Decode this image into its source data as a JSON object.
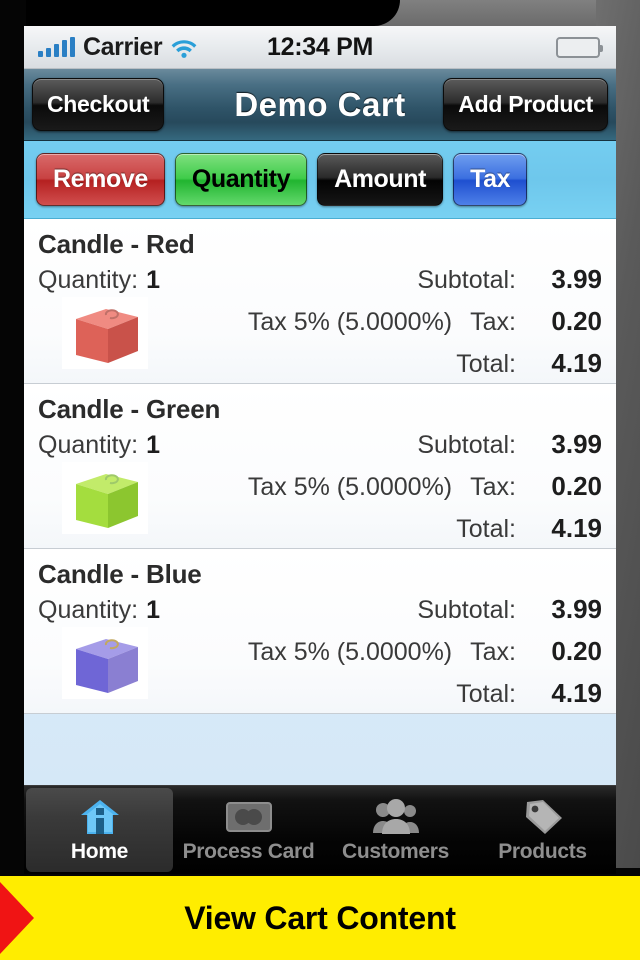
{
  "status_bar": {
    "carrier": "Carrier",
    "time": "12:34 PM",
    "signal_icon": "signal-bars-icon",
    "wifi_icon": "wifi-icon",
    "battery_icon": "battery-icon"
  },
  "nav_bar": {
    "left_button": "Checkout",
    "title": "Demo Cart",
    "right_button": "Add Product"
  },
  "action_bar": {
    "buttons": [
      {
        "label": "Remove",
        "color": "#c84242",
        "text_color": "#ffffff"
      },
      {
        "label": "Quantity",
        "color": "#3fcc4a",
        "text_color": "#000000"
      },
      {
        "label": "Amount",
        "color": "#0a0a0a",
        "text_color": "#ffffff"
      },
      {
        "label": "Tax",
        "color": "#3b6fe0",
        "text_color": "#ffffff"
      }
    ]
  },
  "cart": {
    "labels": {
      "quantity": "Quantity:",
      "subtotal": "Subtotal:",
      "tax": "Tax:",
      "total": "Total:"
    },
    "items": [
      {
        "name": "Candle - Red",
        "quantity": "1",
        "subtotal": "3.99",
        "tax_description": "Tax 5% (5.0000%)",
        "tax": "0.20",
        "total": "4.19",
        "thumbnail": "candle-red-thumbnail",
        "color": "#e06a62"
      },
      {
        "name": "Candle - Green",
        "quantity": "1",
        "subtotal": "3.99",
        "tax_description": "Tax 5% (5.0000%)",
        "tax": "0.20",
        "total": "4.19",
        "thumbnail": "candle-green-thumbnail",
        "color": "#9ed93f"
      },
      {
        "name": "Candle - Blue",
        "quantity": "1",
        "subtotal": "3.99",
        "tax_description": "Tax 5% (5.0000%)",
        "tax": "0.20",
        "total": "4.19",
        "thumbnail": "candle-blue-thumbnail",
        "color": "#6e68d8"
      }
    ]
  },
  "tab_bar": {
    "tabs": [
      {
        "label": "Home",
        "icon": "home-icon",
        "active": true
      },
      {
        "label": "Process Card",
        "icon": "credit-card-icon",
        "active": false
      },
      {
        "label": "Customers",
        "icon": "people-icon",
        "active": false
      },
      {
        "label": "Products",
        "icon": "tag-icon",
        "active": false
      }
    ]
  },
  "caption": {
    "text": "View Cart Content",
    "background": "#ffed00",
    "arrow_color": "#f01414"
  }
}
